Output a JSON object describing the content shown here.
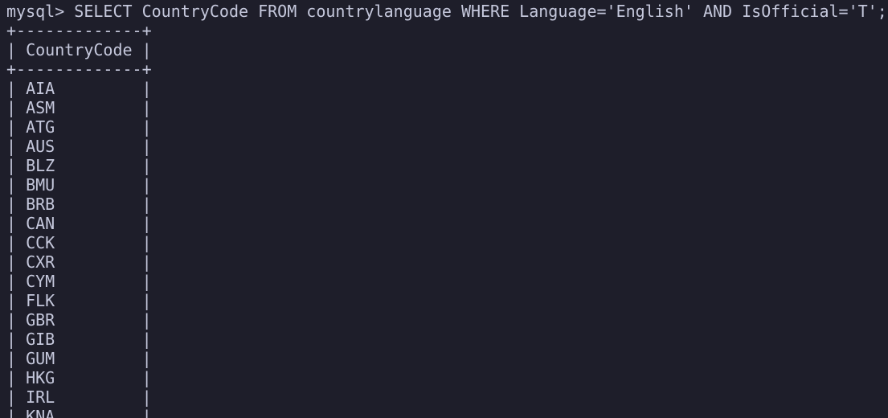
{
  "terminal": {
    "prompt": "mysql> ",
    "command": "SELECT CountryCode FROM countrylanguage WHERE Language='English' AND IsOfficial='T';",
    "border": "+-------------+",
    "header": "CountryCode",
    "rows": [
      "AIA",
      "ASM",
      "ATG",
      "AUS",
      "BLZ",
      "BMU",
      "BRB",
      "CAN",
      "CCK",
      "CXR",
      "CYM",
      "FLK",
      "GBR",
      "GIB",
      "GUM",
      "HKG",
      "IRL",
      "KNA"
    ]
  },
  "colors": {
    "background": "#1e1e2a",
    "text": "#c5c8dc"
  }
}
